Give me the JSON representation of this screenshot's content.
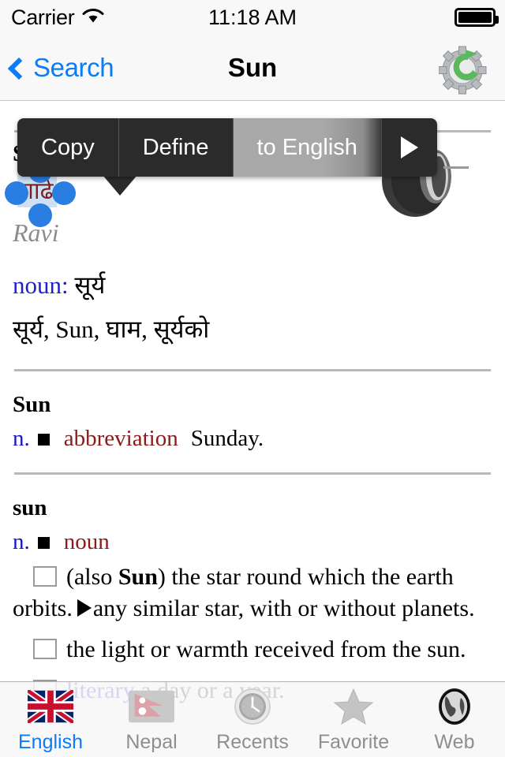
{
  "status_bar": {
    "carrier": "Carrier",
    "wifi_icon": "wifi-icon",
    "time": "11:18 AM",
    "battery_icon": "battery-full-icon"
  },
  "nav_bar": {
    "back_label": "Search",
    "back_icon": "chevron-left-icon",
    "title": "Sun",
    "right_icon": "gear-refresh-icon"
  },
  "edit_menu": {
    "items": [
      {
        "label": "Copy",
        "name": "copy-menu-item",
        "state": "normal"
      },
      {
        "label": "Define",
        "name": "define-menu-item",
        "state": "normal"
      },
      {
        "label": "to English",
        "name": "to-english-menu-item",
        "state": "highlighted"
      }
    ],
    "more_icon": "play-arrow-icon"
  },
  "content": {
    "speaker_icon": "speaker-icon",
    "entry_main": {
      "headword": "Sun",
      "selected_word": "गाढे",
      "transliteration": "Ravi",
      "pos_label": "noun:",
      "pos_value": "सूर्य",
      "translations": "सूर्य, Sun, घाम, सूर्यको"
    },
    "entry_abbrev": {
      "headword": "Sun",
      "gram_abbr": "n.",
      "bullet": "■",
      "category": "abbreviation",
      "definition": "Sunday."
    },
    "entry_noun": {
      "headword": "sun",
      "gram_abbr": "n.",
      "bullet": "■",
      "category": "noun",
      "senses": [
        {
          "text_before": "(also ",
          "bold": "Sun",
          "text_after": ") the star round which the earth orbits.",
          "sub_marker": "▶",
          "sub_text": "any similar star, with or without planets."
        },
        {
          "text": "the light or warmth received from the sun."
        },
        {
          "label": "literary",
          "text": "a day or a year."
        }
      ]
    }
  },
  "tab_bar": {
    "tabs": [
      {
        "label": "English",
        "icon": "uk-flag-icon",
        "active": true
      },
      {
        "label": "Nepal",
        "icon": "nepal-flag-icon",
        "active": false
      },
      {
        "label": "Recents",
        "icon": "clock-icon",
        "active": false
      },
      {
        "label": "Favorite",
        "icon": "star-icon",
        "active": false
      },
      {
        "label": "Web",
        "icon": "globe-icon",
        "active": false
      }
    ]
  },
  "colors": {
    "ios_blue": "#0b7bf7",
    "pos_blue": "#2020d0",
    "category_red": "#8b1a1a",
    "selection_blue": "#2a7de1",
    "menu_dark": "#2b2b2b",
    "tab_inactive": "#8e8e93"
  }
}
